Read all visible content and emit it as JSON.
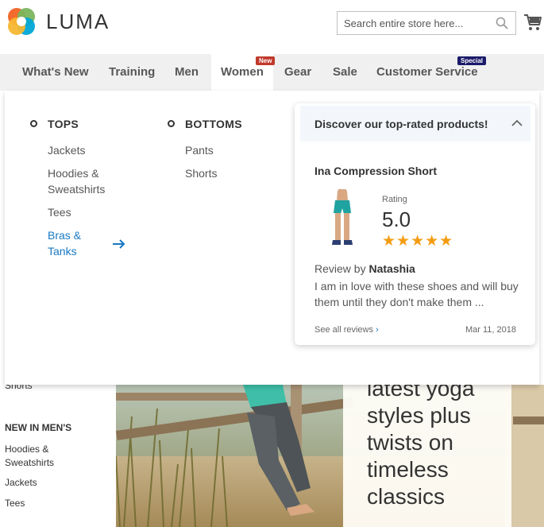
{
  "header": {
    "logo_text": "LUMA",
    "search_placeholder": "Search entire store here...",
    "logo_colors": [
      "#f26322",
      "#7ab55c",
      "#00a6d6",
      "#f7b731"
    ]
  },
  "nav": {
    "items": [
      {
        "label": "What's New"
      },
      {
        "label": "Training"
      },
      {
        "label": "Men"
      },
      {
        "label": "Women",
        "badge": "New"
      },
      {
        "label": "Gear"
      },
      {
        "label": "Sale"
      },
      {
        "label": "Customer Service",
        "badge": "Special"
      }
    ],
    "active_item": "Women"
  },
  "dropdown": {
    "tops": {
      "heading": "TOPS",
      "links": [
        "Jackets",
        "Hoodies &\nSweatshirts",
        "Tees",
        "Bras &\nTanks"
      ],
      "active_link": "Bras &\nTanks"
    },
    "bottoms": {
      "heading": "BOTTOMS",
      "links": [
        "Pants",
        "Shorts"
      ]
    }
  },
  "product_card": {
    "title": "Discover our top-rated products!",
    "product_name": "Ina Compression Short",
    "rating_label": "Rating",
    "rating_value": "5.0",
    "stars": 5,
    "stars_text": "★★★★★",
    "review_by_prefix": "Review by",
    "reviewer": "Natashia",
    "review_text": "I am in love with these shoes and will buy them until they don't make them ...",
    "see_all": "See all reviews",
    "date": "Mar 11, 2018",
    "star_color": "#f39c12",
    "link_color": "#1979c3"
  },
  "background": {
    "sidebar_link_top": "Shorts",
    "sidebar_heading": "NEW IN MEN'S",
    "sidebar_links": [
      "Hoodies &\nSweatshirts",
      "Jackets",
      "Tees"
    ],
    "hero_text": "latest yoga styles plus twists on timeless classics"
  }
}
